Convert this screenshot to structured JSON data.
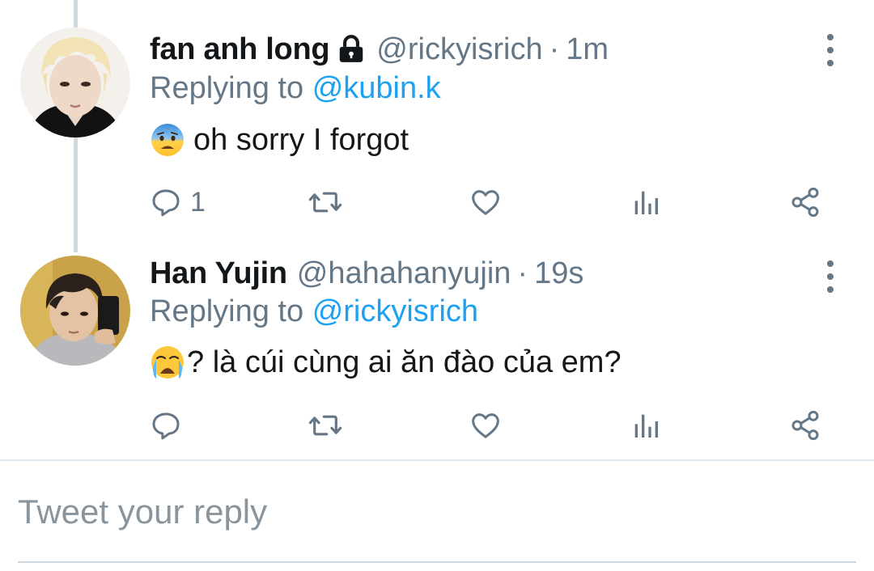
{
  "tweets": [
    {
      "display_name": "fan anh long",
      "protected": true,
      "handle": "@rickyisrich",
      "separator": "·",
      "time": "1m",
      "replying_prefix": "Replying to",
      "replying_to": "@kubin.k",
      "emoji": "anxious-face-with-sweat",
      "text": "oh sorry I forgot",
      "reply_count": "1"
    },
    {
      "display_name": "Han Yujin",
      "protected": false,
      "handle": "@hahahanyujin",
      "separator": "·",
      "time": "19s",
      "replying_prefix": "Replying to",
      "replying_to": "@rickyisrich",
      "emoji": "loudly-crying-face",
      "text": "? là cúi cùng ai ăn đào của em?",
      "reply_count": ""
    }
  ],
  "composer": {
    "placeholder": "Tweet your reply"
  },
  "colors": {
    "text": "#14171a",
    "secondary": "#657786",
    "link": "#1da1f2",
    "divider": "#e1e8ed",
    "thread_line": "#cfd9de"
  }
}
